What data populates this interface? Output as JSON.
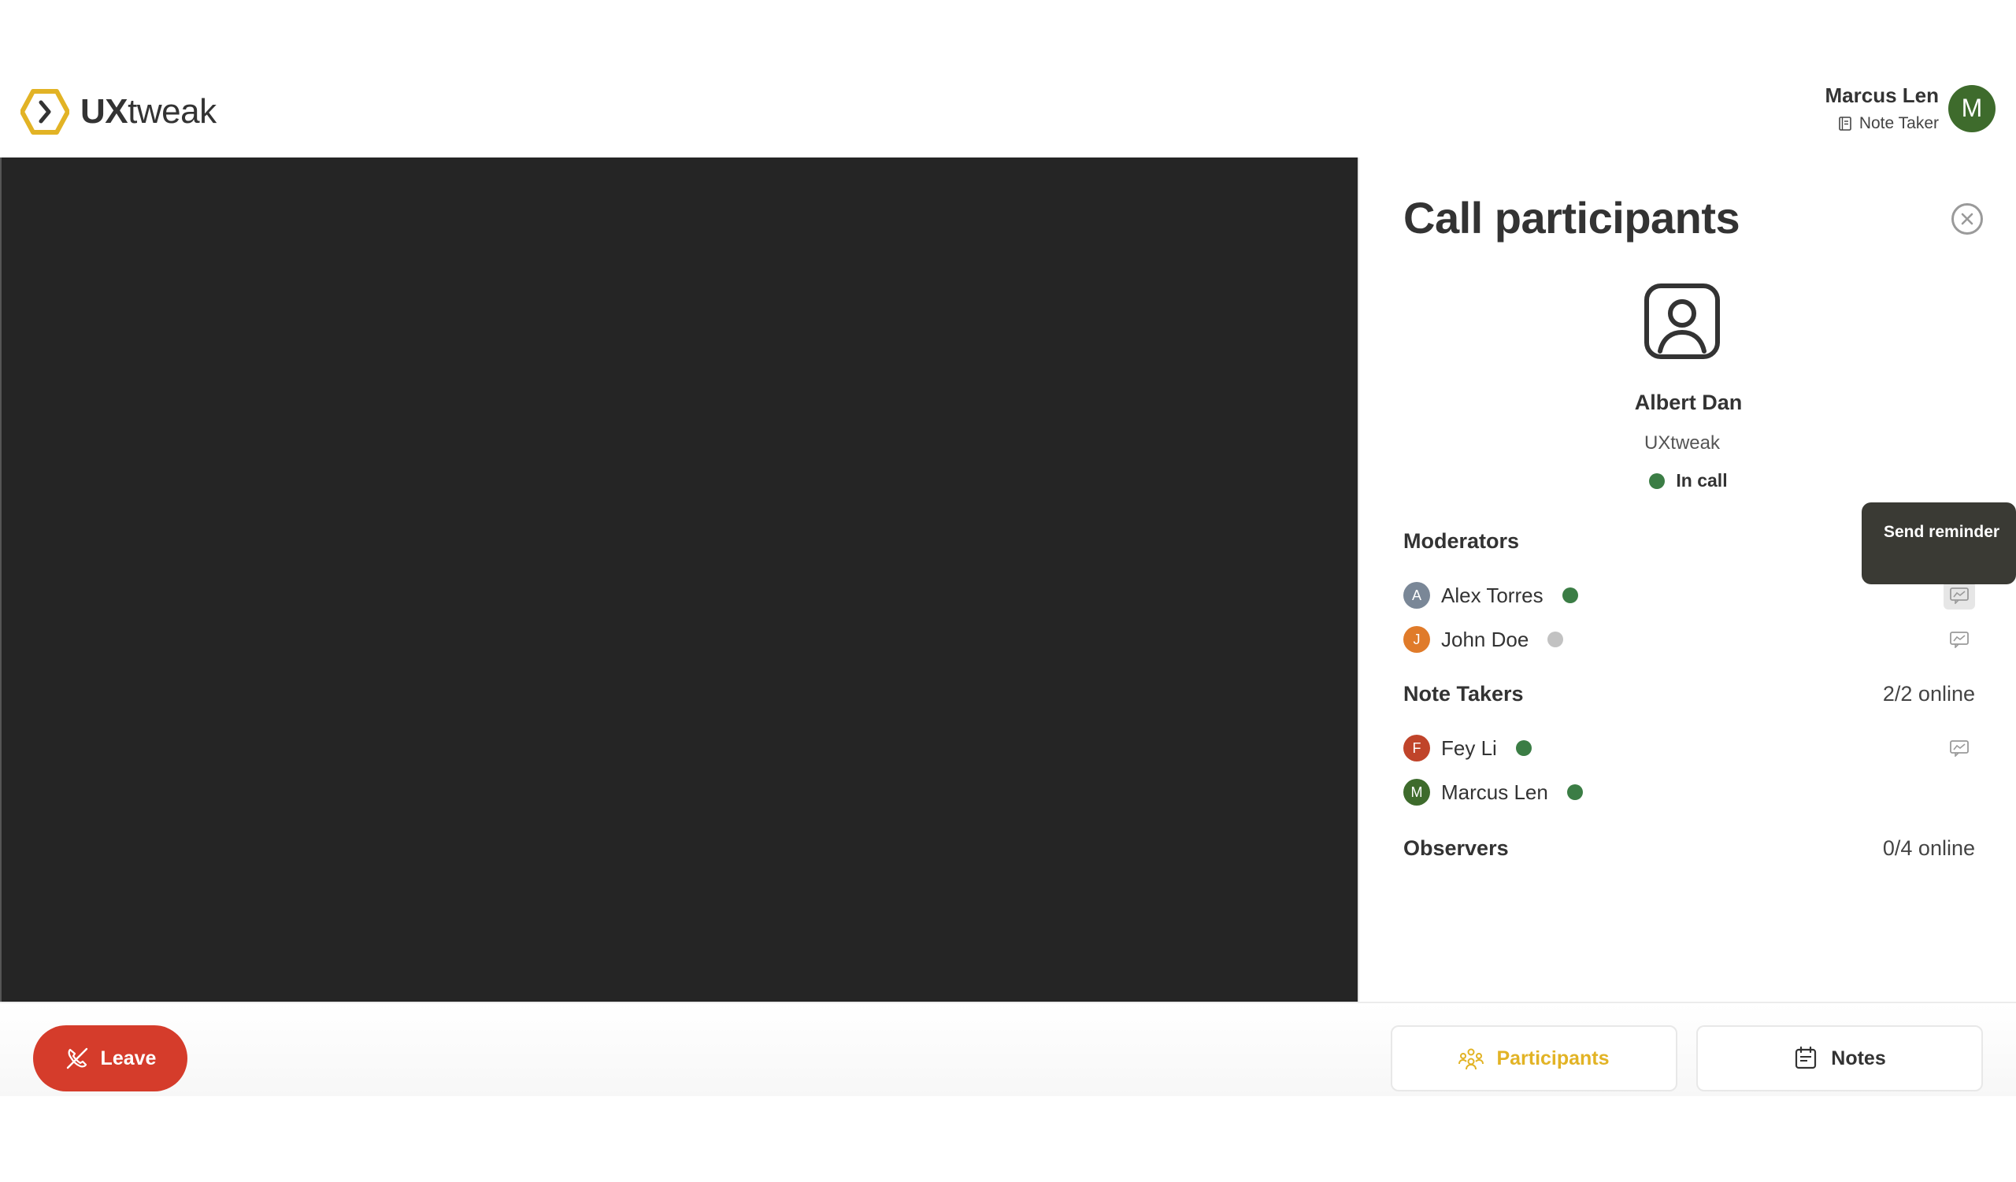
{
  "header": {
    "logo_bold": "UX",
    "logo_rest": "tweak",
    "user": {
      "name": "Marcus Len",
      "role": "Note Taker",
      "avatar_letter": "M"
    }
  },
  "panel": {
    "title": "Call participants",
    "respondent": {
      "name": "Albert Dan",
      "org": "UXtweak",
      "status": "In call"
    },
    "tooltip": "Send reminder",
    "sections": {
      "moderators": {
        "label": "Moderators",
        "people": [
          {
            "letter": "A",
            "name": "Alex Torres",
            "color": "#7a8797",
            "online": true
          },
          {
            "letter": "J",
            "name": "John Doe",
            "color": "#e07b2a",
            "online": false
          }
        ]
      },
      "note_takers": {
        "label": "Note Takers",
        "count": "2/2 online",
        "people": [
          {
            "letter": "F",
            "name": "Fey Li",
            "color": "#c0442a",
            "online": true
          },
          {
            "letter": "M",
            "name": "Marcus Len",
            "color": "#3e6b2c",
            "online": true
          }
        ]
      },
      "observers": {
        "label": "Observers",
        "count": "0/4 online"
      }
    }
  },
  "bottombar": {
    "leave": "Leave",
    "participants_tab": "Participants",
    "notes_tab": "Notes"
  },
  "colors": {
    "accent": "#e2b325",
    "leave": "#d53c2b",
    "online": "#3b7d45",
    "offline": "#c2c2c2"
  }
}
